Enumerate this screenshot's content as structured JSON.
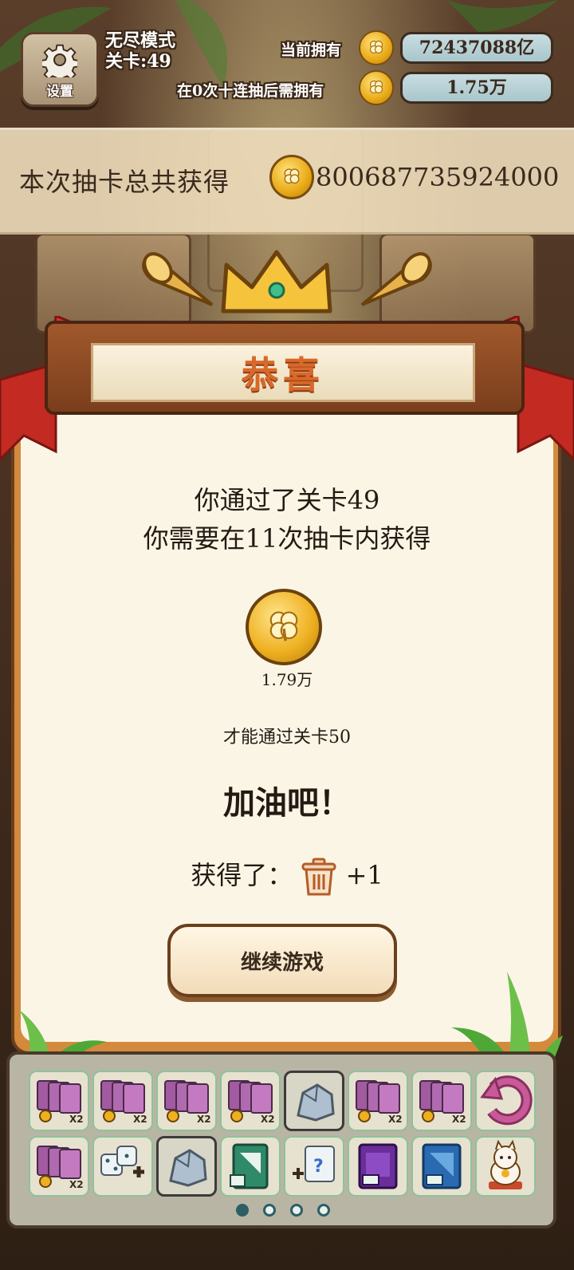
{
  "hud": {
    "settings_label": "设置",
    "mode": "无尽模式",
    "level": "关卡:49",
    "owned_label": "当前拥有",
    "owned_value": "72437088亿",
    "cost_label": "在0次十连抽后需拥有",
    "cost_value": "1.75万"
  },
  "banner": {
    "text": "本次抽卡总共获得",
    "value": "800687735924000"
  },
  "popup": {
    "title": "恭喜",
    "line1": "你通过了关卡49",
    "line2": "你需要在11次抽卡内获得",
    "coin_amount": "1.79万",
    "line3": "才能通过关卡50",
    "cheer": "加油吧！",
    "reward_label": "获得了：",
    "reward_count": "+1",
    "continue_label": "继续游戏"
  },
  "inventory": {
    "row1": [
      "card-pack-x2-icon",
      "card-pack-x2-icon",
      "card-pack-x2-icon",
      "card-pack-x2-icon",
      "rock-icon",
      "card-pack-x2-icon",
      "card-pack-x2-icon",
      "undo-arrow-icon"
    ],
    "row2": [
      "card-pack-x2-icon",
      "dice-add-icon",
      "rock-icon",
      "green-card-icon",
      "mystery-card-add-icon",
      "purple-card-pack-icon",
      "blue-card-pack-icon",
      "lucky-cat-icon"
    ],
    "x2_label": "×2",
    "page_count": 4,
    "active_page": 1
  },
  "colors": {
    "accent": "#d9692a",
    "coin": "#eeb020",
    "popup_border": "#d38a3d"
  }
}
